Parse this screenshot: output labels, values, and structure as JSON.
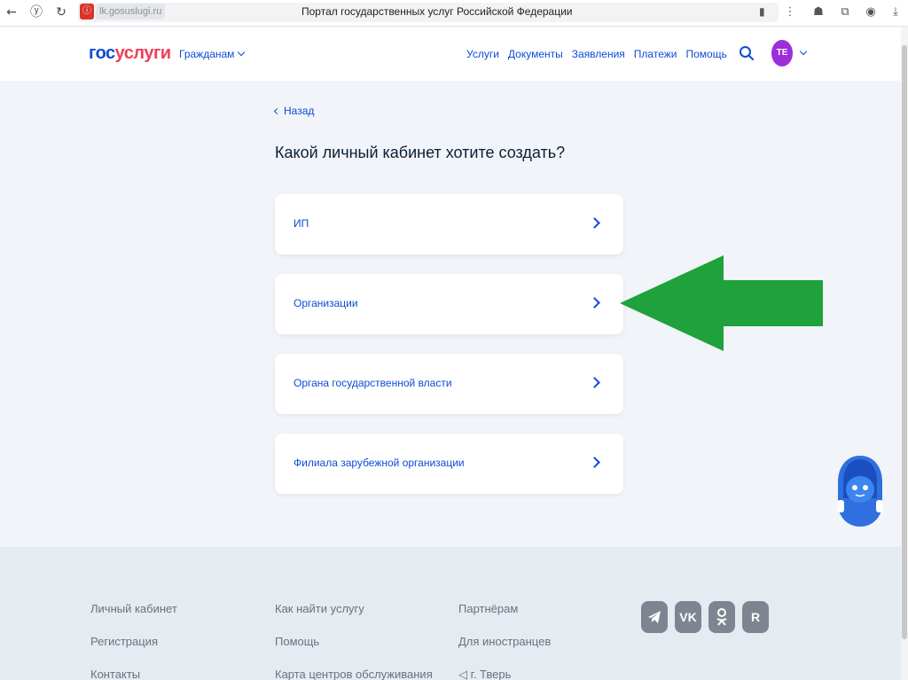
{
  "browser": {
    "url": "lk.gosuslugi.ru",
    "page_title": "Портал государственных услуг Российской Федерации",
    "icons": [
      "back-arrow-icon",
      "yandex-icon",
      "reload-icon",
      "bookmark-icon",
      "menu-dots-icon",
      "extension-icon",
      "download-icon"
    ]
  },
  "header": {
    "logo_part1": "гос",
    "logo_part2": "услуги",
    "audience": "Гражданам",
    "nav": [
      "Услуги",
      "Документы",
      "Заявления",
      "Платежи",
      "Помощь"
    ],
    "avatar_initials": "ТЕ"
  },
  "main": {
    "back_label": "Назад",
    "title": "Какой личный кабинет хотите создать?",
    "options": [
      {
        "label": "ИП"
      },
      {
        "label": "Организации"
      },
      {
        "label": "Органа государственной власти"
      },
      {
        "label": "Филиала зарубежной организации"
      }
    ]
  },
  "footer": {
    "col1": [
      "Личный кабинет",
      "Регистрация",
      "Контакты"
    ],
    "col2": [
      "Как найти услугу",
      "Помощь",
      "Карта центров обслуживания"
    ],
    "col3": [
      "Партнёрам",
      "Для иностранцев",
      "г. Тверь"
    ],
    "socials": [
      "telegram-icon",
      "vk-icon",
      "odnoklassniki-icon",
      "rutube-icon"
    ]
  },
  "colors": {
    "brand_blue": "#0d4cd3",
    "brand_red": "#ee3f58",
    "annotation_green": "#1fa23c",
    "avatar": "#9b2fd8"
  }
}
